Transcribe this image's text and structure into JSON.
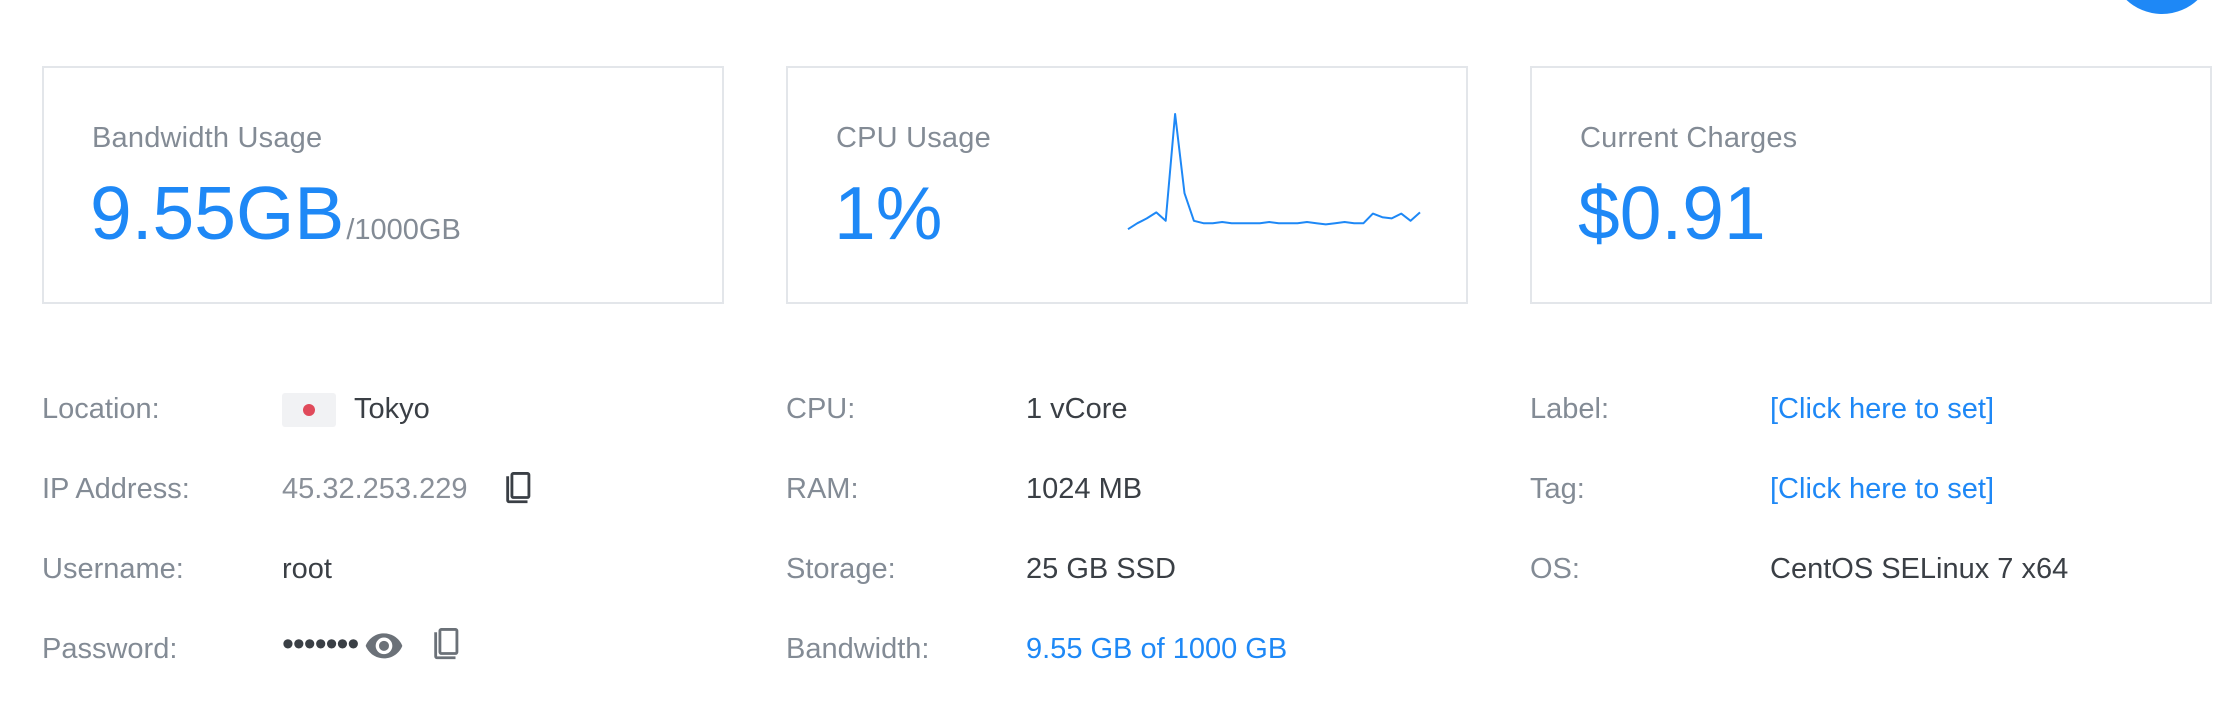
{
  "cards": {
    "bandwidth": {
      "title": "Bandwidth Usage",
      "value": "9.55GB",
      "suffix": "/1000GB"
    },
    "cpu": {
      "title": "CPU Usage",
      "value": "1%",
      "sparkline": [
        4,
        9,
        13,
        18,
        11,
        100,
        34,
        11,
        9,
        9,
        10,
        9,
        9,
        9,
        9,
        10,
        9,
        9,
        9,
        10,
        9,
        8,
        9,
        10,
        9,
        9,
        17,
        14,
        13,
        17,
        11,
        18
      ]
    },
    "charges": {
      "title": "Current Charges",
      "value": "$0.91"
    }
  },
  "details": {
    "location": {
      "label": "Location:",
      "value": "Tokyo",
      "flag": "japan-flag"
    },
    "ip": {
      "label": "IP Address:",
      "value": "45.32.253.229"
    },
    "username": {
      "label": "Username:",
      "value": "root"
    },
    "password": {
      "label": "Password:",
      "masked": "•••••••"
    },
    "cpu": {
      "label": "CPU:",
      "value": "1 vCore"
    },
    "ram": {
      "label": "RAM:",
      "value": "1024 MB"
    },
    "storage": {
      "label": "Storage:",
      "value": "25 GB SSD"
    },
    "bandwidth": {
      "label": "Bandwidth:",
      "value": "9.55 GB of 1000 GB"
    },
    "server_label": {
      "label": "Label:",
      "value": "[Click here to set]"
    },
    "tag": {
      "label": "Tag:",
      "value": "[Click here to set]"
    },
    "os": {
      "label": "OS:",
      "value": "CentOS SELinux 7 x64"
    }
  },
  "colors": {
    "accent": "#1e88f6",
    "muted": "#838b95",
    "text": "#3a3f45",
    "border": "#e3e6ea"
  },
  "icons": {
    "copy": "copy-icon",
    "eye": "eye-icon"
  }
}
